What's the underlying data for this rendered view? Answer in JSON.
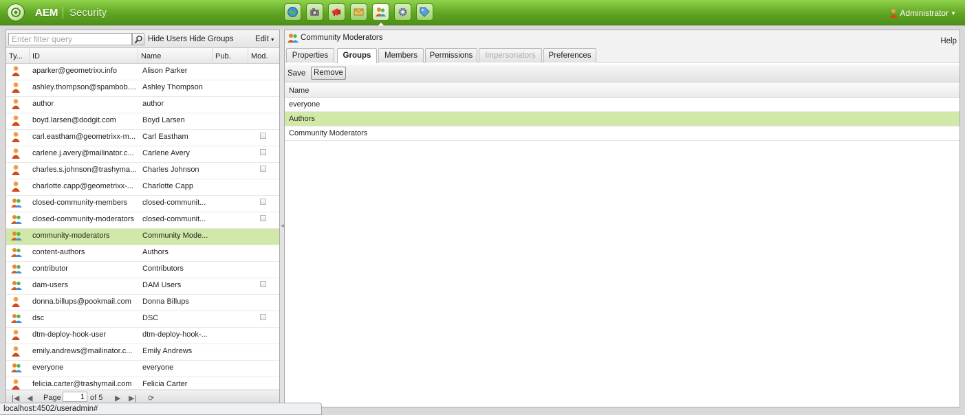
{
  "app": {
    "name": "AEM",
    "section": "Security"
  },
  "nav_icons": [
    {
      "name": "websites-icon"
    },
    {
      "name": "digital-assets-icon"
    },
    {
      "name": "campaigns-icon"
    },
    {
      "name": "inbox-icon"
    },
    {
      "name": "users-icon",
      "active": true
    },
    {
      "name": "tools-icon"
    },
    {
      "name": "tagging-icon"
    }
  ],
  "user_menu": {
    "label": "Administrator"
  },
  "left": {
    "filter_placeholder": "Enter filter query",
    "hide_users": "Hide Users",
    "hide_groups": "Hide Groups",
    "edit": "Edit",
    "columns": {
      "type": "Ty...",
      "id": "ID",
      "name": "Name",
      "pub": "Pub.",
      "mod": "Mod."
    },
    "rows": [
      {
        "type": "user",
        "id": "aparker@geometrixx.info",
        "name": "Alison Parker",
        "mod": false
      },
      {
        "type": "user",
        "id": "ashley.thompson@spambob....",
        "name": "Ashley Thompson",
        "mod": false
      },
      {
        "type": "user",
        "id": "author",
        "name": "author",
        "mod": false
      },
      {
        "type": "user",
        "id": "boyd.larsen@dodgit.com",
        "name": "Boyd Larsen",
        "mod": false
      },
      {
        "type": "user",
        "id": "carl.eastham@geometrixx-m...",
        "name": "Carl Eastham",
        "mod": true
      },
      {
        "type": "user",
        "id": "carlene.j.avery@mailinator.c...",
        "name": "Carlene Avery",
        "mod": true
      },
      {
        "type": "user",
        "id": "charles.s.johnson@trashyma...",
        "name": "Charles Johnson",
        "mod": true
      },
      {
        "type": "user",
        "id": "charlotte.capp@geometrixx-...",
        "name": "Charlotte Capp",
        "mod": false
      },
      {
        "type": "group",
        "id": "closed-community-members",
        "name": "closed-communit...",
        "mod": true
      },
      {
        "type": "group",
        "id": "closed-community-moderators",
        "name": "closed-communit...",
        "mod": true
      },
      {
        "type": "group",
        "id": "community-moderators",
        "name": "Community Mode...",
        "mod": false,
        "selected": true
      },
      {
        "type": "group",
        "id": "content-authors",
        "name": "Authors",
        "mod": false
      },
      {
        "type": "group",
        "id": "contributor",
        "name": "Contributors",
        "mod": false
      },
      {
        "type": "group",
        "id": "dam-users",
        "name": "DAM Users",
        "mod": true
      },
      {
        "type": "user",
        "id": "donna.billups@pookmail.com",
        "name": "Donna Billups",
        "mod": false
      },
      {
        "type": "group",
        "id": "dsc",
        "name": "DSC",
        "mod": true
      },
      {
        "type": "user",
        "id": "dtm-deploy-hook-user",
        "name": "dtm-deploy-hook-...",
        "mod": false
      },
      {
        "type": "user",
        "id": "emily.andrews@mailinator.c...",
        "name": "Emily Andrews",
        "mod": false
      },
      {
        "type": "group",
        "id": "everyone",
        "name": "everyone",
        "mod": false
      },
      {
        "type": "user",
        "id": "felicia.carter@trashymail.com",
        "name": "Felicia Carter",
        "mod": false
      }
    ],
    "pager": {
      "page_label": "Page",
      "page_value": "1",
      "of_label": "of 5"
    }
  },
  "right": {
    "title": "Community Moderators",
    "help": "Help",
    "tabs": [
      {
        "label": "Properties"
      },
      {
        "label": "Groups",
        "active": true
      },
      {
        "label": "Members"
      },
      {
        "label": "Permissions"
      },
      {
        "label": "Impersonators",
        "disabled": true
      },
      {
        "label": "Preferences"
      }
    ],
    "toolbar": {
      "save": "Save",
      "remove": "Remove"
    },
    "groups_header": "Name",
    "groups": [
      {
        "name": "everyone"
      },
      {
        "name": "Authors",
        "selected": true
      },
      {
        "name": "Community Moderators"
      }
    ]
  },
  "status_bar": {
    "url": "localhost:4502/useradmin#"
  },
  "colors": {
    "brand_green": "#5fa522",
    "selection": "#d2e8a8"
  }
}
